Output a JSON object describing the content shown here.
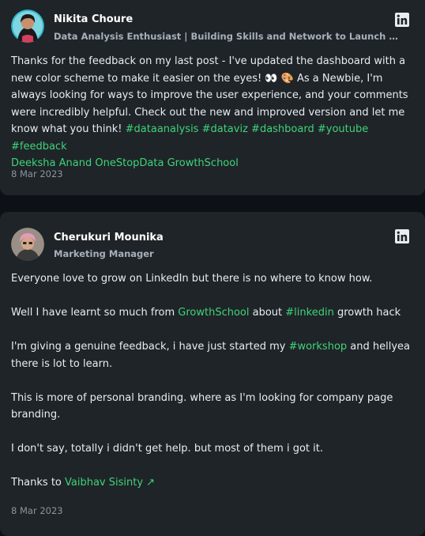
{
  "posts": [
    {
      "author": "Nikita Choure",
      "headline": "Data Analysis Enthusiast | Building Skills and Network to Launch a Career i...",
      "text": "Thanks for the feedback on my last post - I've updated the dashboard with a new color scheme to make it easier on the eyes! 👀 🎨 As a Newbie, I'm always looking for ways to improve the user experience, and your comments were incredibly helpful. Check out the new and improved version and let me know what you think!",
      "hashtags": [
        "#dataanalysis",
        "#dataviz",
        "#dashboard",
        "#youtube",
        "#feedback"
      ],
      "mentions": [
        "Deeksha Anand",
        "OneStopData",
        "GrowthSchool"
      ],
      "date": "8 Mar 2023"
    },
    {
      "author": "Cherukuri Mounika",
      "headline": "Marketing Manager",
      "p1": "Everyone love to grow on LinkedIn but there is no where to know how.",
      "p2_a": "Well I have learnt so much from ",
      "p2_link1": "GrowthSchool",
      "p2_b": " about ",
      "p2_link2": "#linkedin",
      "p2_c": " growth hack",
      "p3_a": "I'm giving a genuine feedback, i have just started my ",
      "p3_link": "#workshop",
      "p3_b": " and hellyea there is lot to learn.",
      "p4": "This is more of personal branding. where as I'm looking for company page branding.",
      "p5": "I don't say, totally i didn't get help. but most of them i got it.",
      "p6_a": "Thanks to ",
      "p6_link": "Vaibhav Sisinty ↗",
      "date": "8 Mar 2023"
    }
  ],
  "colors": {
    "accent": "#3fd37a",
    "card": "#1f2428",
    "page": "#0d1117"
  },
  "icons": {
    "network": "linkedin-icon"
  }
}
